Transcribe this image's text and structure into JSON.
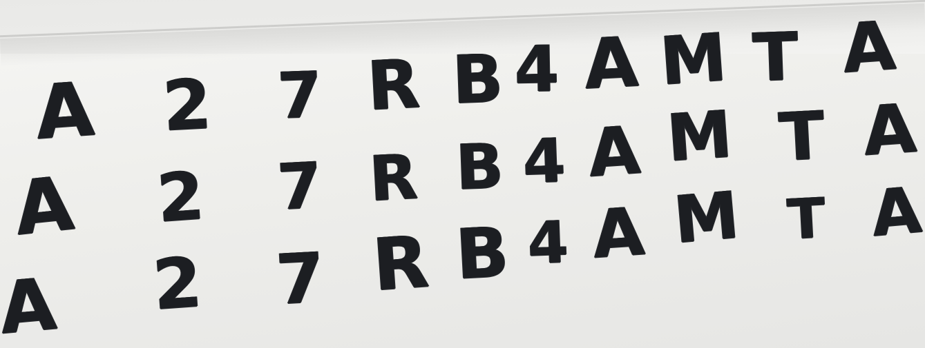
{
  "photo": {
    "description_alt": "",
    "rows": [
      [
        "A",
        "2",
        "7",
        "R",
        "B",
        "4",
        "A",
        "M",
        "T",
        "A"
      ],
      [
        "A",
        "2",
        "7",
        "R",
        "B",
        "4",
        "A",
        "M",
        "T",
        "A"
      ],
      [
        "A",
        "2",
        "7",
        "R",
        "B",
        "4",
        "A",
        "M",
        "T",
        "A"
      ]
    ]
  }
}
